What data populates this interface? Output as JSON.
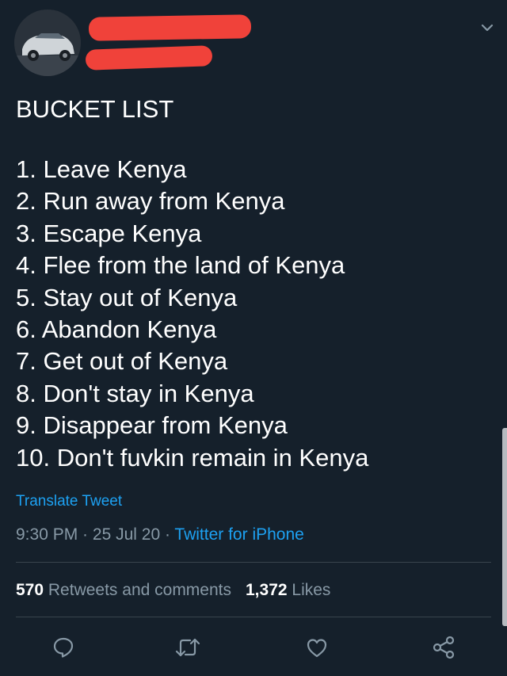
{
  "tweet": {
    "title": "BUCKET LIST",
    "items": [
      "1. Leave Kenya",
      "2. Run away from Kenya",
      "3. Escape Kenya",
      "4. Flee from the land of Kenya",
      "5. Stay out of Kenya",
      "6. Abandon Kenya",
      "7. Get out of Kenya",
      "8. Don't stay in Kenya",
      "9. Disappear from Kenya",
      "10. Don't fuvkin remain in Kenya"
    ],
    "translate_label": "Translate Tweet",
    "time": "9:30 PM",
    "separator": " · ",
    "date": "25 Jul 20",
    "source": "Twitter for iPhone"
  },
  "stats": {
    "retweets_count": "570",
    "retweets_label": "Retweets and comments",
    "likes_count": "1,372",
    "likes_label": "Likes"
  },
  "icons": {
    "reply": "comment-icon",
    "retweet": "retweet-icon",
    "like": "heart-icon",
    "share": "share-icon",
    "menu": "chevron-down-icon"
  },
  "colors": {
    "background": "#15202b",
    "accent": "#1da1f2",
    "muted": "#8899a6",
    "redaction": "#f0423a"
  }
}
